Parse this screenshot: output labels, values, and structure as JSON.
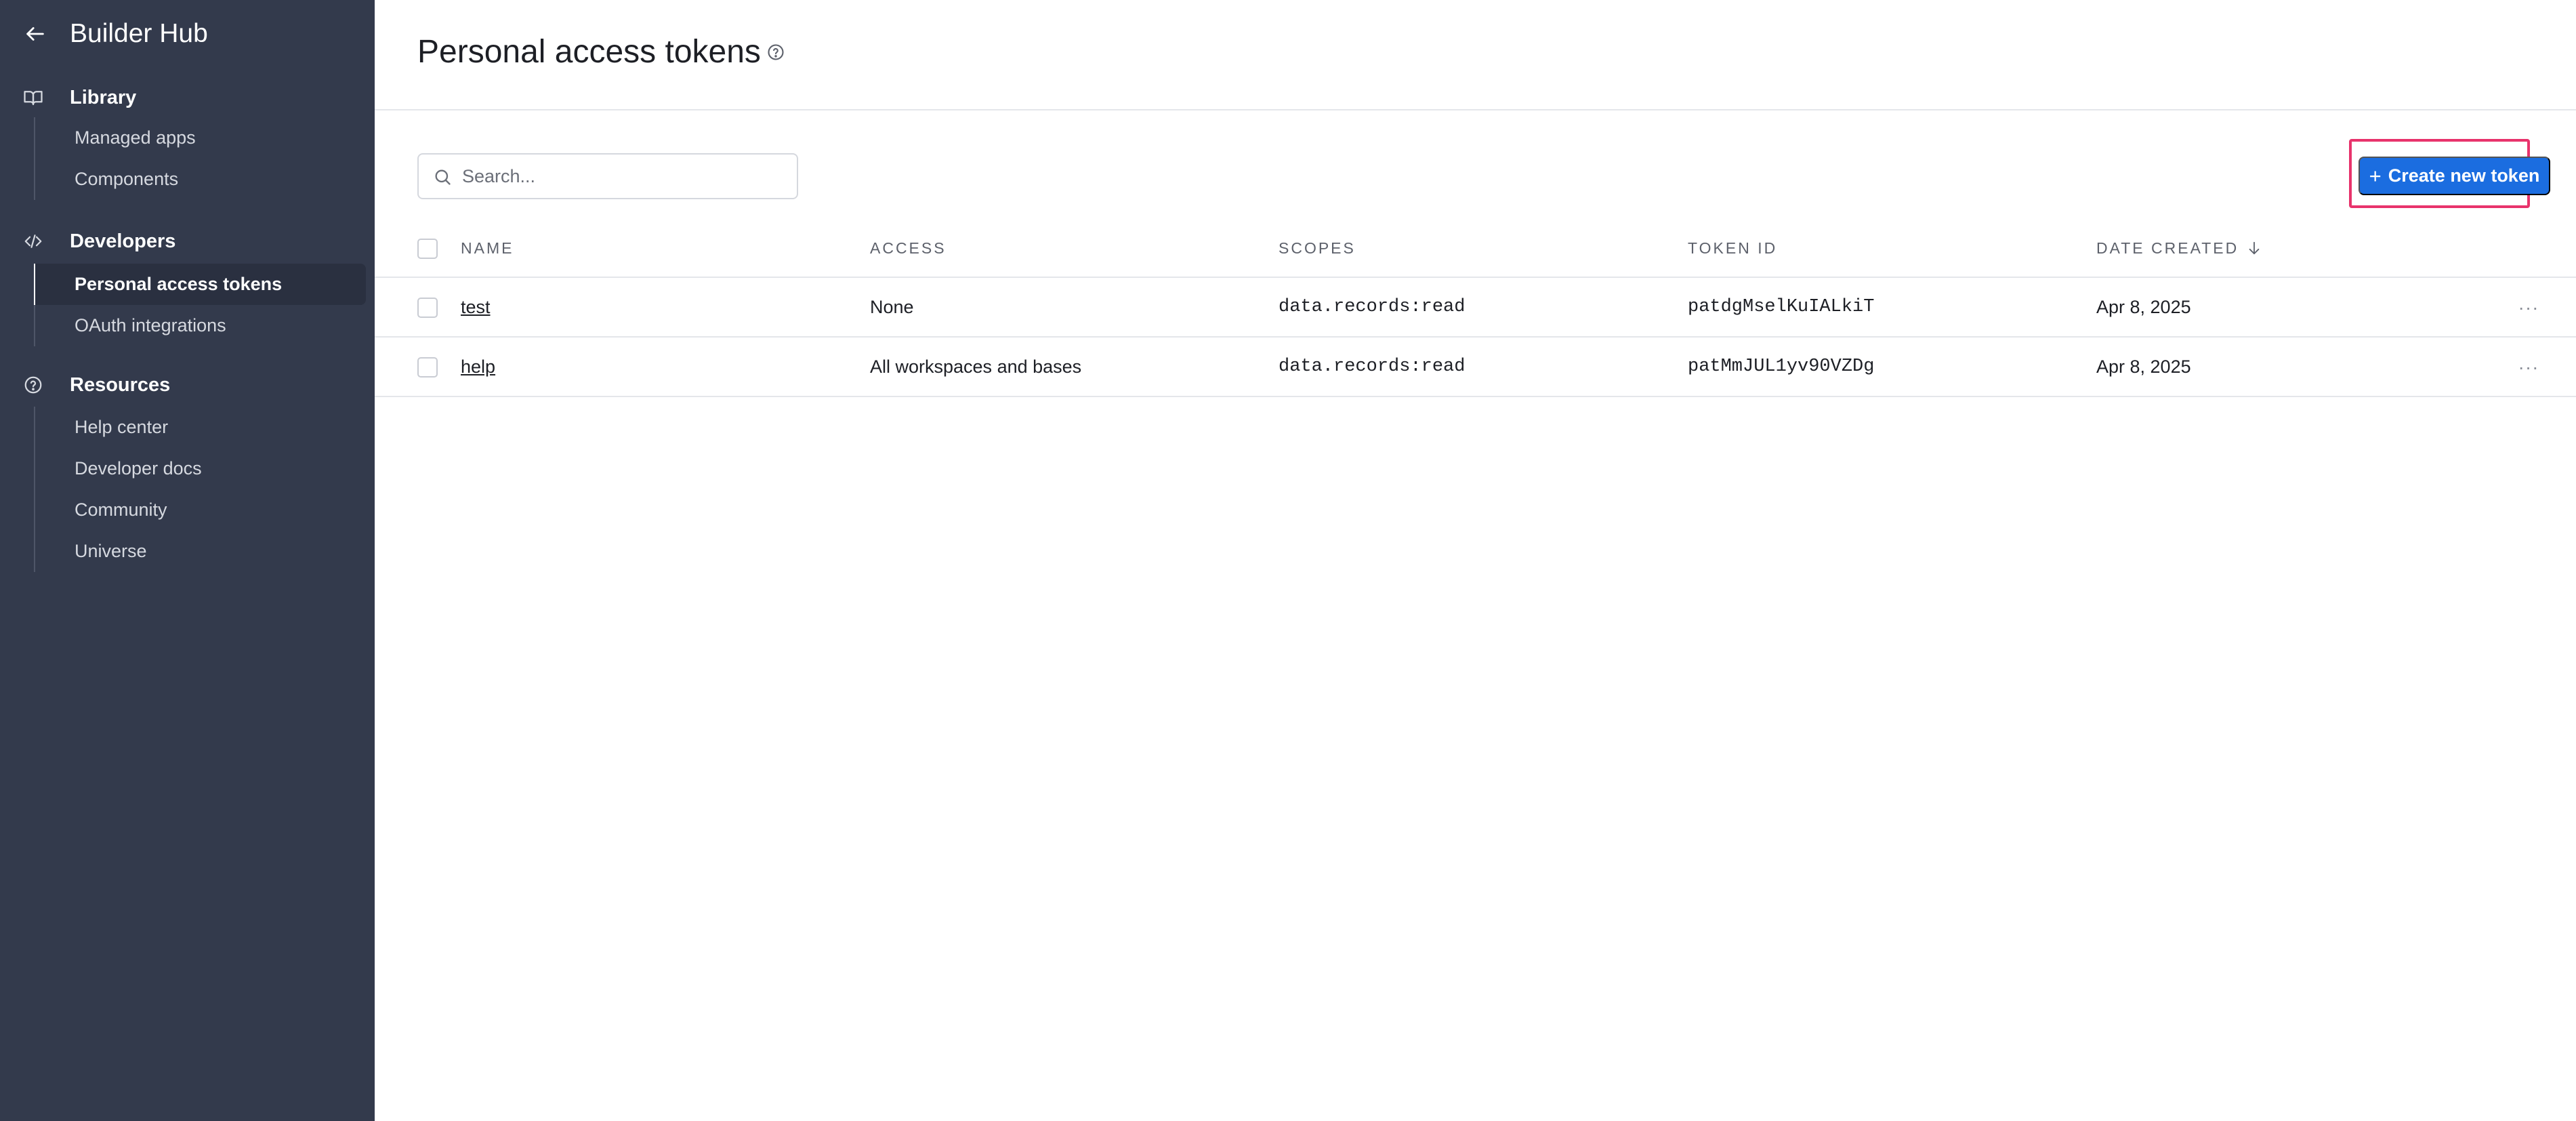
{
  "sidebar": {
    "title": "Builder Hub",
    "sections": [
      {
        "label": "Library",
        "icon": "book-icon",
        "items": [
          "Managed apps",
          "Components"
        ]
      },
      {
        "label": "Developers",
        "icon": "code-icon",
        "items": [
          "Personal access tokens",
          "OAuth integrations"
        ],
        "active_item": "Personal access tokens"
      },
      {
        "label": "Resources",
        "icon": "help-circle-icon",
        "items": [
          "Help center",
          "Developer docs",
          "Community",
          "Universe"
        ]
      }
    ]
  },
  "page": {
    "title": "Personal access tokens",
    "search_placeholder": "Search...",
    "create_button_label": "Create new token",
    "create_button_icon": "plus-icon"
  },
  "table": {
    "headers": {
      "name": "NAME",
      "access": "ACCESS",
      "scopes": "SCOPES",
      "token_id": "TOKEN ID",
      "date_created": "DATE CREATED"
    },
    "sort": {
      "column": "date_created",
      "direction": "descending"
    },
    "rows": [
      {
        "name": "test",
        "access": "None",
        "scopes": "data.records:read",
        "token_id": "patdgMselKuIALkiT",
        "date_created": "Apr 8, 2025",
        "menu": "···"
      },
      {
        "name": "help",
        "access": "All workspaces and bases",
        "scopes": "data.records:read",
        "token_id": "patMmJUL1yv90VZDg",
        "date_created": "Apr 8, 2025",
        "menu": "···"
      }
    ]
  },
  "colors": {
    "sidebar_bg": "#333a4c",
    "primary_button": "#1b6de0",
    "highlight_border": "#e8336c"
  }
}
